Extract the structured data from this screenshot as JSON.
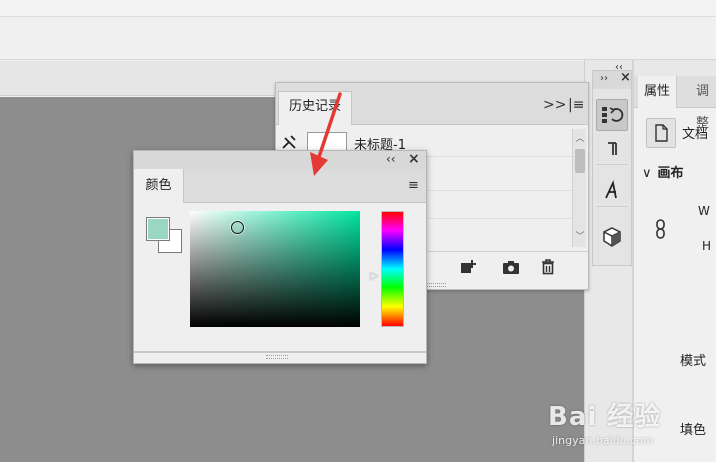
{
  "history_panel": {
    "tab_label": "历史记录",
    "collapse_icon": "double-chevron-right-icon",
    "menu_icon": "hamburger-menu-icon",
    "rows": [
      {
        "name": "未标题-1"
      }
    ],
    "footer": {
      "new_document_icon": "new-document-from-state-icon",
      "snapshot_icon": "camera-icon",
      "delete_icon": "trash-icon"
    }
  },
  "color_panel": {
    "tab_label": "颜色",
    "foreground_color": "#9ad7c3",
    "background_color": "#ffffff",
    "field_hue_color": "#00e5a0",
    "menu_icon": "hamburger-menu-icon"
  },
  "properties_panel": {
    "tabs": [
      "属性",
      "调整"
    ],
    "document_label": "文档",
    "section_title": "画布",
    "w_label": "W",
    "h_label": "H",
    "mode_label": "模式",
    "fill_label": "填色"
  },
  "toolstrip": {
    "buttons": [
      "history-icon",
      "paragraph-icon",
      "character-icon",
      "3d-cube-icon"
    ]
  },
  "watermark": {
    "brand": "Bai 经验",
    "url": "jingyan.baidu.com"
  },
  "annotation": {
    "arrow_color": "#e53935"
  }
}
